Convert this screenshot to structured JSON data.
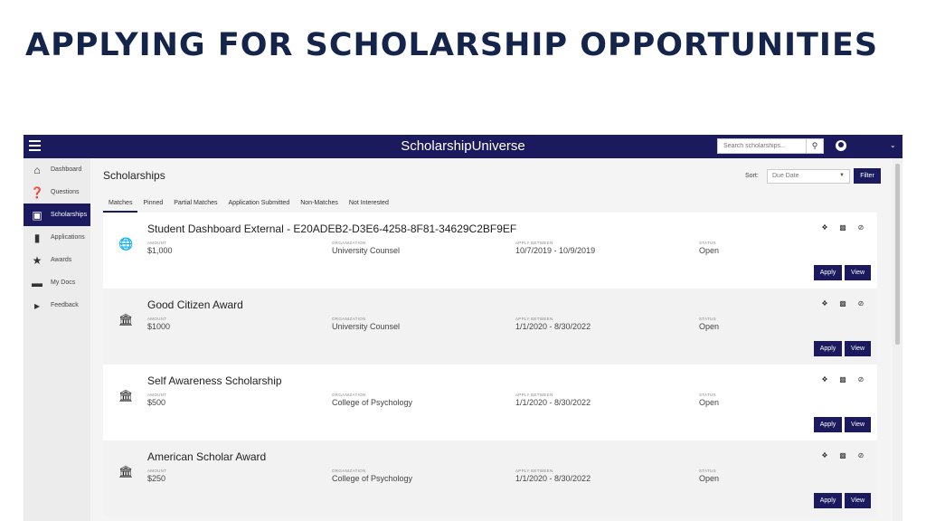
{
  "slide": {
    "title": "APPLYING FOR SCHOLARSHIP OPPORTUNITIES"
  },
  "app": {
    "brand": "ScholarshipUniverse",
    "search_placeholder": "Search scholarships...",
    "colors": {
      "primary": "#1c1a5e",
      "sidebar": "#ececec"
    }
  },
  "sidebar": {
    "items": [
      {
        "label": "Dashboard",
        "icon": "home-icon"
      },
      {
        "label": "Questions",
        "icon": "question-icon"
      },
      {
        "label": "Scholarships",
        "icon": "money-icon",
        "active": true
      },
      {
        "label": "Applications",
        "icon": "document-icon"
      },
      {
        "label": "Awards",
        "icon": "trophy-icon"
      },
      {
        "label": "My Docs",
        "icon": "folder-icon"
      },
      {
        "label": "Feedback",
        "icon": "megaphone-icon"
      }
    ]
  },
  "main": {
    "page_title": "Scholarships",
    "sort_label": "Sort:",
    "sort_value": "Due Date",
    "filter_label": "Filter",
    "tabs": [
      {
        "label": "Matches",
        "active": true
      },
      {
        "label": "Pinned"
      },
      {
        "label": "Partial Matches"
      },
      {
        "label": "Application Submitted"
      },
      {
        "label": "Non-Matches"
      },
      {
        "label": "Not Interested"
      }
    ],
    "field_labels": {
      "amount": "AMOUNT",
      "organization": "ORGANIZATION",
      "apply_between": "APPLY BETWEEN",
      "status": "STATUS"
    },
    "apply_label": "Apply",
    "view_label": "View",
    "scholarships": [
      {
        "title": "Student Dashboard External - E20ADEB2-D3E6-4258-8F81-34629C2BF9EF",
        "amount": "$1,000",
        "organization": "University Counsel",
        "apply_between": "10/7/2019 - 10/9/2019",
        "status": "Open",
        "icon": "globe-icon"
      },
      {
        "title": "Good Citizen Award",
        "amount": "$1000",
        "organization": "University Counsel",
        "apply_between": "1/1/2020 - 8/30/2022",
        "status": "Open",
        "icon": "institution-icon"
      },
      {
        "title": "Self Awareness Scholarship",
        "amount": "$500",
        "organization": "College of Psychology",
        "apply_between": "1/1/2020 - 8/30/2022",
        "status": "Open",
        "icon": "institution-icon"
      },
      {
        "title": "American Scholar Award",
        "amount": "$250",
        "organization": "College of Psychology",
        "apply_between": "1/1/2020 - 8/30/2022",
        "status": "Open",
        "icon": "institution-icon"
      }
    ]
  }
}
